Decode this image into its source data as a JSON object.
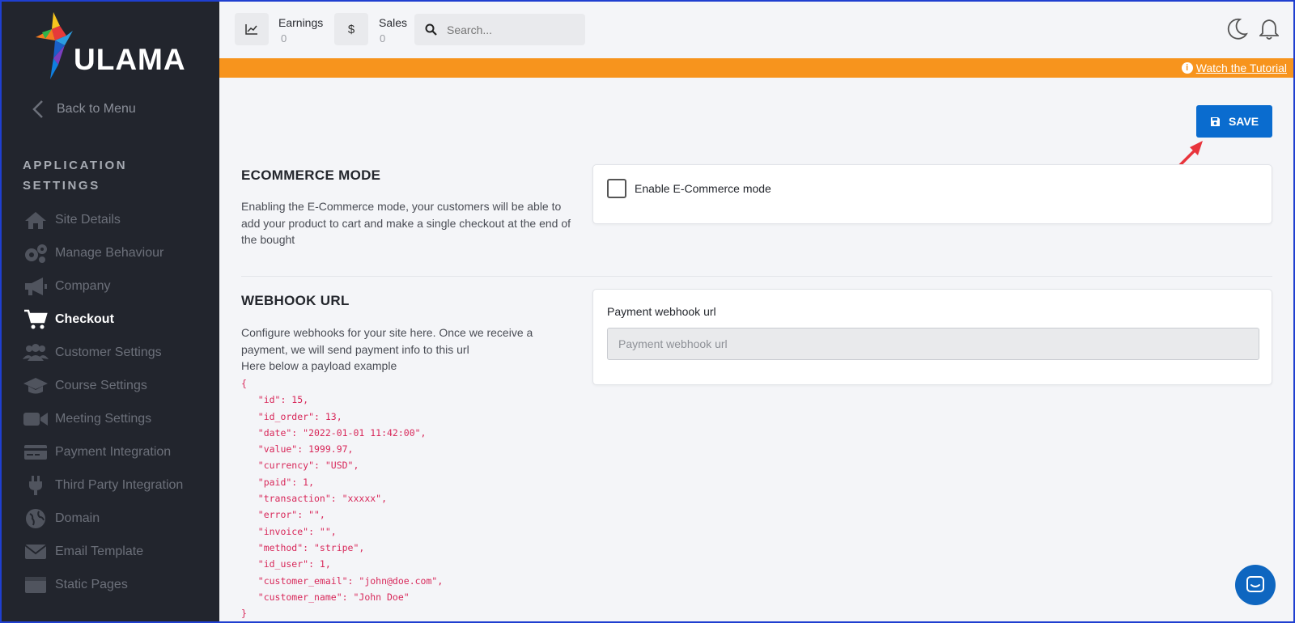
{
  "brand": {
    "name": "ULAMA"
  },
  "sidebar": {
    "back_label": "Back to Menu",
    "section_title": "APPLICATION SETTINGS",
    "items": [
      {
        "label": "Site Details",
        "icon": "home-icon",
        "active": false
      },
      {
        "label": "Manage Behaviour",
        "icon": "gears-icon",
        "active": false
      },
      {
        "label": "Company",
        "icon": "megaphone-icon",
        "active": false
      },
      {
        "label": "Checkout",
        "icon": "cart-icon",
        "active": true
      },
      {
        "label": "Customer Settings",
        "icon": "users-icon",
        "active": false
      },
      {
        "label": "Course Settings",
        "icon": "graduation-cap-icon",
        "active": false
      },
      {
        "label": "Meeting Settings",
        "icon": "video-icon",
        "active": false
      },
      {
        "label": "Payment Integration",
        "icon": "credit-card-icon",
        "active": false
      },
      {
        "label": "Third Party Integration",
        "icon": "plug-icon",
        "active": false
      },
      {
        "label": "Domain",
        "icon": "globe-icon",
        "active": false
      },
      {
        "label": "Email Template",
        "icon": "envelope-icon",
        "active": false
      },
      {
        "label": "Static Pages",
        "icon": "window-icon",
        "active": false
      }
    ]
  },
  "header": {
    "earnings": {
      "label": "Earnings",
      "value": "0"
    },
    "sales": {
      "label": "Sales",
      "value": "0",
      "symbol": "$"
    },
    "search": {
      "placeholder": "Search..."
    }
  },
  "banner": {
    "link_label": "Watch the Tutorial",
    "info_glyph": "i"
  },
  "toolbar": {
    "save_label": "SAVE"
  },
  "ecommerce": {
    "title": "ECOMMERCE MODE",
    "description": "Enabling the E-Commerce mode, your customers will be able to add your product to cart and make a single checkout at the end of the bought",
    "checkbox_label": "Enable E-Commerce mode",
    "checked": false
  },
  "webhook": {
    "title": "WEBHOOK URL",
    "description": "Configure webhooks for your site here. Once we receive a payment, we will send payment info to this url",
    "payload_intro": "Here below a payload example",
    "field_label": "Payment webhook url",
    "field_placeholder": "Payment webhook url",
    "field_value": "",
    "payload_lines": [
      "{",
      "   \"id\": 15,",
      "   \"id_order\": 13,",
      "   \"date\": \"2022-01-01 11:42:00\",",
      "   \"value\": 1999.97,",
      "   \"currency\": \"USD\",",
      "   \"paid\": 1,",
      "   \"transaction\": \"xxxxx\",",
      "   \"error\": \"\",",
      "   \"invoice\": \"\",",
      "   \"method\": \"stripe\",",
      "   \"id_user\": 1,",
      "   \"customer_email\": \"john@doe.com\",",
      "   \"customer_name\": \"John Doe\"",
      "}"
    ]
  },
  "colors": {
    "sidebar_bg": "#22252d",
    "accent": "#0a6ccf",
    "banner": "#f7941d",
    "code": "#d8285a",
    "annotation_arrow": "#e8343c"
  }
}
